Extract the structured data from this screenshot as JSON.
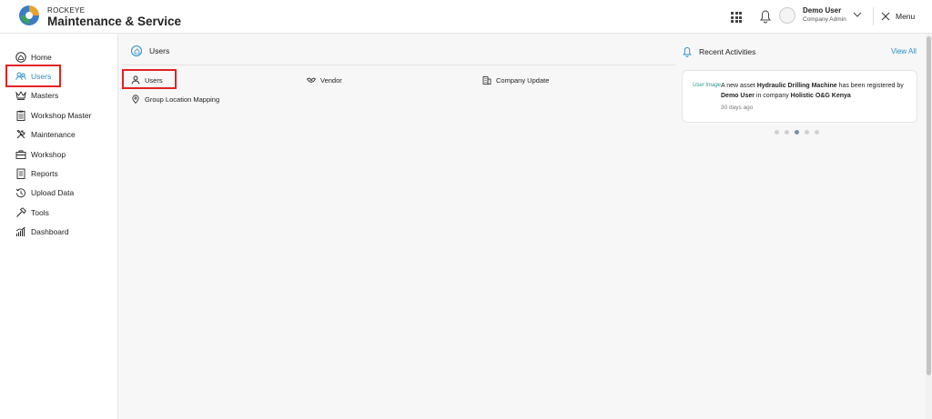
{
  "header": {
    "brand_small": "ROCKEYE",
    "brand_title": "Maintenance & Service",
    "user_name": "Demo User",
    "user_role": "Company Admin",
    "menu_label": "Menu"
  },
  "sidebar": {
    "items": [
      {
        "label": "Home",
        "icon": "home-icon"
      },
      {
        "label": "Users",
        "icon": "users-icon",
        "active": true
      },
      {
        "label": "Masters",
        "icon": "crown-icon"
      },
      {
        "label": "Workshop Master",
        "icon": "clipboard-icon"
      },
      {
        "label": "Maintenance",
        "icon": "tools-icon"
      },
      {
        "label": "Workshop",
        "icon": "briefcase-icon"
      },
      {
        "label": "Reports",
        "icon": "report-icon"
      },
      {
        "label": "Upload Data",
        "icon": "history-icon"
      },
      {
        "label": "Tools",
        "icon": "hammer-icon"
      },
      {
        "label": "Dashboard",
        "icon": "bar-chart-icon"
      }
    ]
  },
  "main": {
    "breadcrumb": "Users",
    "subitems": [
      {
        "label": "Users",
        "icon": "user-icon"
      },
      {
        "label": "Vendor",
        "icon": "handshake-icon"
      },
      {
        "label": "Company Update",
        "icon": "building-icon"
      },
      {
        "label": "Group Location Mapping",
        "icon": "location-pin-icon"
      }
    ]
  },
  "activities": {
    "title": "Recent Activities",
    "view_all": "View All",
    "image_alt": "User Image",
    "line1_prefix": "A new asset ",
    "asset_name": "Hydraulic Drilling Machine",
    "line1_suffix": " has been registered by",
    "user": "Demo User",
    "line2_middle": " in company ",
    "company": "Holistic O&G Kenya",
    "time": "30 days ago",
    "carousel_active_index": 2,
    "carousel_count": 5
  },
  "colors": {
    "accent": "#2c8cc9",
    "highlight_box": "#e32222"
  }
}
